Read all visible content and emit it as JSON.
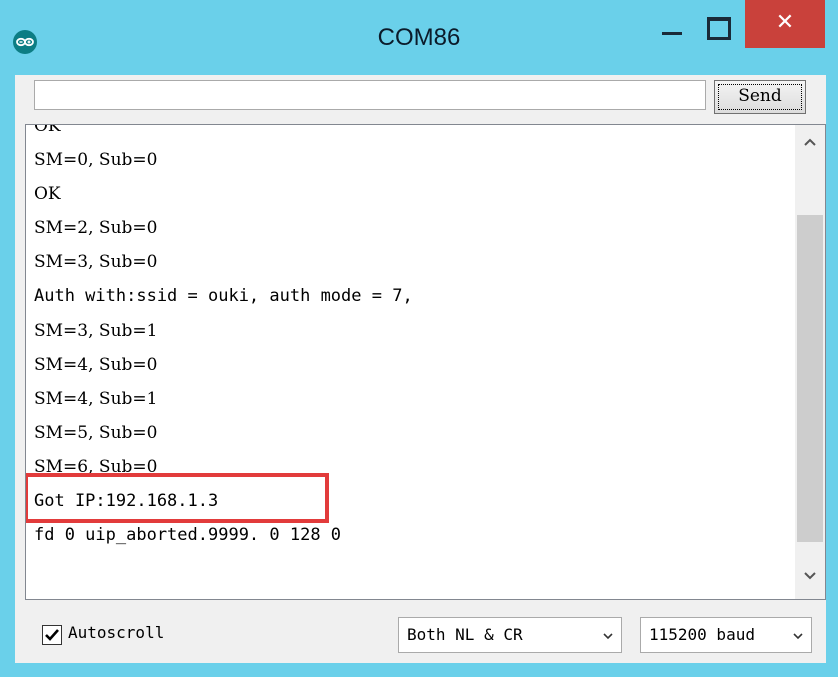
{
  "window": {
    "title": "COM86"
  },
  "send": {
    "input_value": "",
    "button_label": "Send"
  },
  "output": {
    "lines": [
      "OK",
      "SM=0, Sub=0",
      "OK",
      "SM=2, Sub=0",
      "SM=3, Sub=0",
      "Auth with:ssid = ouki, auth mode = 7,",
      "SM=3, Sub=1",
      "SM=4, Sub=0",
      "SM=4, Sub=1",
      "SM=5, Sub=0",
      "SM=6, Sub=0",
      "Got IP:192.168.1.3",
      "fd 0 uip_aborted.9999. 0 128 0"
    ],
    "highlight_color": "#e23b3b"
  },
  "footer": {
    "autoscroll_label": "Autoscroll",
    "autoscroll_checked": true,
    "line_ending": "Both NL & CR",
    "baud": "115200 baud"
  },
  "colors": {
    "titlebar": "#6ad0ea",
    "close_button": "#c9413b",
    "app_icon": "#0c7d84"
  }
}
